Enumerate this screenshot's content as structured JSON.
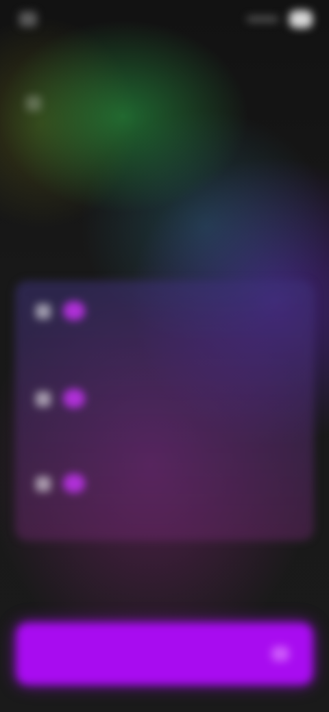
{
  "status_bar": {
    "time": "",
    "carrier": ""
  },
  "header": {
    "title": "",
    "subtitle": ""
  },
  "options": [
    {
      "badge": "",
      "title": "",
      "description": ""
    },
    {
      "badge": "",
      "title": "",
      "description": ""
    },
    {
      "badge": "",
      "title": "",
      "description": ""
    }
  ],
  "footnote": "",
  "continue_button": {
    "label": ""
  },
  "colors": {
    "accent": "#a80cf0",
    "badge": "#b030d8",
    "background": "#141414"
  },
  "icons": {
    "status_left": "app-icon",
    "back": "back-arrow-icon",
    "option": "option-icon",
    "continue": "chevron-right-icon"
  }
}
